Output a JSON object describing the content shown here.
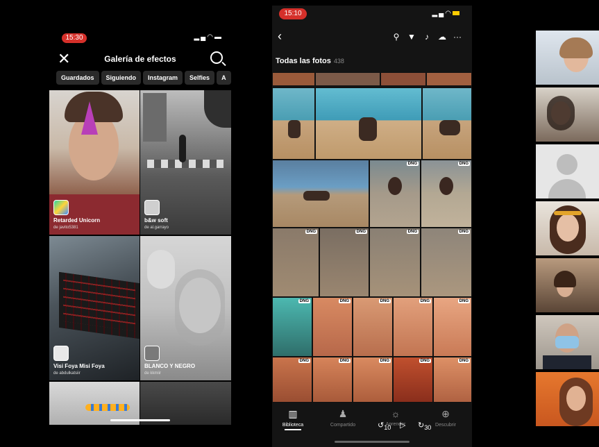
{
  "left_phone": {
    "time": "15:30",
    "title": "Galería de efectos",
    "chips": [
      "Guardados",
      "Siguiendo",
      "Instagram",
      "Selfies",
      "A"
    ],
    "effects": [
      {
        "title": "Retarded Unicorn",
        "author": "de javito5381"
      },
      {
        "title": "b&w soft",
        "author": "de al.garrayo"
      },
      {
        "title": "Visi Foya Misi Foya",
        "author": "de abdulkatsiir"
      },
      {
        "title": "BLANCO Y NEGRO",
        "author": "de kkmiir"
      }
    ]
  },
  "middle_phone": {
    "time": "15:10",
    "album_title": "Todas las fotos",
    "photo_count": "438",
    "dng_badge": "DNG",
    "tabs": [
      {
        "label": "Biblioteca",
        "icon": "library-icon"
      },
      {
        "label": "Compartido",
        "icon": "people-icon"
      },
      {
        "label": "Aprender",
        "icon": "lightbulb-icon"
      },
      {
        "label": "Descubrir",
        "icon": "globe-icon"
      }
    ],
    "skip_back": "10",
    "skip_forward": "30"
  },
  "colors": {
    "status_red": "#d5302a",
    "battery_yellow": "#ffcc00"
  }
}
